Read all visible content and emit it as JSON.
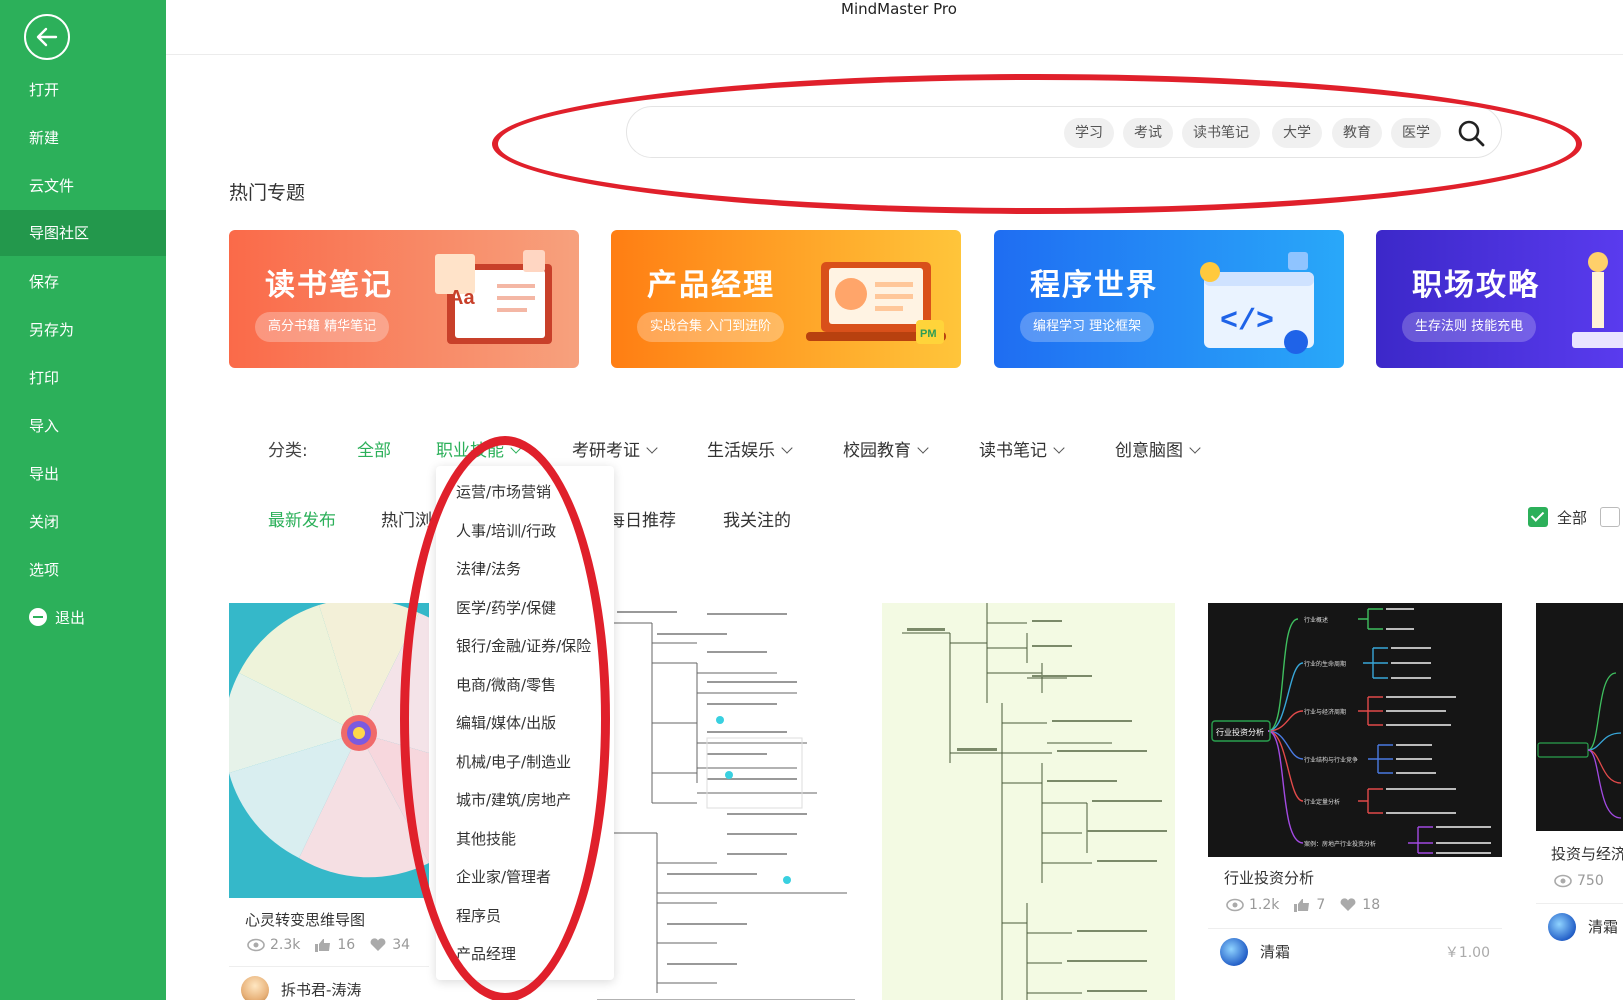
{
  "app": {
    "title": "MindMaster Pro"
  },
  "sidebar": {
    "items": [
      {
        "label": "打开"
      },
      {
        "label": "新建"
      },
      {
        "label": "云文件"
      },
      {
        "label": "导图社区",
        "active": true
      },
      {
        "label": "保存"
      },
      {
        "label": "另存为"
      },
      {
        "label": "打印"
      },
      {
        "label": "导入"
      },
      {
        "label": "导出"
      },
      {
        "label": "关闭"
      },
      {
        "label": "选项"
      },
      {
        "label": "退出"
      }
    ]
  },
  "search": {
    "value": "",
    "tags": [
      "学习",
      "考试",
      "读书笔记",
      "大学",
      "教育",
      "医学"
    ]
  },
  "topics": {
    "title": "热门专题",
    "banners": [
      {
        "title": "读书笔记",
        "subtitle": "高分书籍 精华笔记"
      },
      {
        "title": "产品经理",
        "subtitle": "实战合集 入门到进阶"
      },
      {
        "title": "程序世界",
        "subtitle": "编程学习 理论框架"
      },
      {
        "title": "职场攻略",
        "subtitle": "生存法则 技能充电"
      }
    ]
  },
  "categories": {
    "label": "分类:",
    "items": [
      "全部",
      "职业技能",
      "考研考证",
      "生活娱乐",
      "校园教育",
      "读书笔记",
      "创意脑图"
    ],
    "selected": "全部",
    "open": "职业技能"
  },
  "dropdown": {
    "items": [
      "运营/市场营销",
      "人事/培训/行政",
      "法律/法务",
      "医学/药学/保健",
      "银行/金融/证券/保险",
      "电商/微商/零售",
      "编辑/媒体/出版",
      "机械/电子/制造业",
      "城市/建筑/房地产",
      "其他技能",
      "企业家/管理者",
      "程序员",
      "产品经理"
    ]
  },
  "sort": {
    "tabs": [
      "最新发布",
      "热门浏",
      "每日推荐",
      "我关注的"
    ],
    "selected": "最新发布",
    "filter_all": {
      "label": "全部",
      "checked": true
    }
  },
  "cards": [
    {
      "title": "心灵转变思维导图",
      "views": "2.3k",
      "likes": "16",
      "favs": "34",
      "author": "拆书君-涛涛"
    },
    {
      "title": "行业投资分析",
      "views": "1.2k",
      "likes": "7",
      "favs": "18",
      "author": "清霜",
      "price": "￥1.00"
    },
    {
      "title": "投资与经济",
      "views": "750",
      "author": "清霜"
    }
  ],
  "thumb_text": {
    "root": "行业投资分析",
    "branches": [
      "行业概述",
      "行业的生命周期",
      "行业与经济周期",
      "行业结构与行业竞争",
      "行业定量分析",
      "案例：房地产行业投资分析"
    ]
  },
  "colors": {
    "accent": "#2cb05a",
    "sidebar": "#2cb05a",
    "annotation": "#e0202b"
  }
}
